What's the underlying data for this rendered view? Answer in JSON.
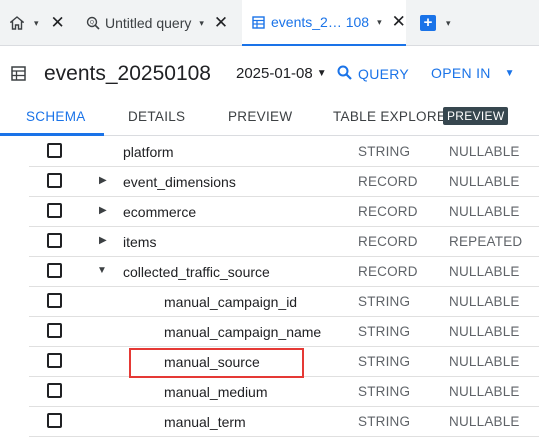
{
  "tabs": {
    "home_caret": "▾",
    "query_title": "Untitled query",
    "events_title": "events_2… 108",
    "close_glyph": "✕"
  },
  "header": {
    "table_name": "events_20250108",
    "date": "2025-01-08",
    "query_label": "QUERY",
    "open_in_label": "OPEN IN"
  },
  "subtabs": {
    "schema": "SCHEMA",
    "details": "DETAILS",
    "preview": "PREVIEW",
    "table_explorer": "TABLE EXPLORER",
    "badge": "PREVIEW"
  },
  "schema_rows": [
    {
      "name": "platform",
      "type": "STRING",
      "mode": "NULLABLE",
      "expander": ""
    },
    {
      "name": "event_dimensions",
      "type": "RECORD",
      "mode": "NULLABLE",
      "expander": "▶"
    },
    {
      "name": "ecommerce",
      "type": "RECORD",
      "mode": "NULLABLE",
      "expander": "▶"
    },
    {
      "name": "items",
      "type": "RECORD",
      "mode": "REPEATED",
      "expander": "▶"
    },
    {
      "name": "collected_traffic_source",
      "type": "RECORD",
      "mode": "NULLABLE",
      "expander": "▼"
    },
    {
      "name": "manual_campaign_id",
      "type": "STRING",
      "mode": "NULLABLE",
      "expander": ""
    },
    {
      "name": "manual_campaign_name",
      "type": "STRING",
      "mode": "NULLABLE",
      "expander": ""
    },
    {
      "name": "manual_source",
      "type": "STRING",
      "mode": "NULLABLE",
      "expander": ""
    },
    {
      "name": "manual_medium",
      "type": "STRING",
      "mode": "NULLABLE",
      "expander": ""
    },
    {
      "name": "manual_term",
      "type": "STRING",
      "mode": "NULLABLE",
      "expander": ""
    }
  ],
  "highlighted_field": "manual_source",
  "colors": {
    "accent": "#1a73e8",
    "highlight": "#e53935"
  }
}
